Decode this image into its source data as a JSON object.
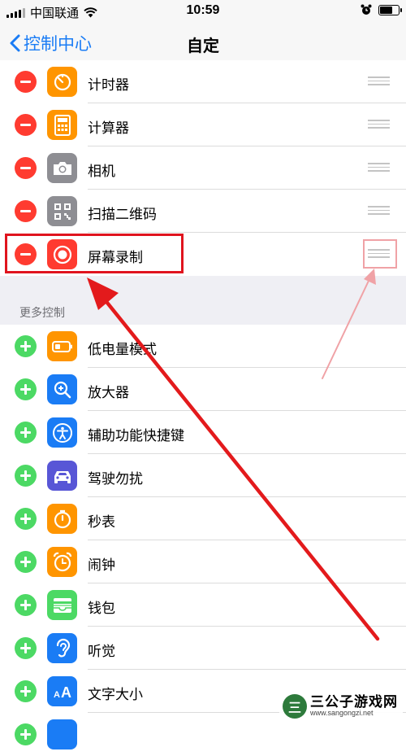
{
  "status_bar": {
    "carrier": "中国联通",
    "time": "10:59",
    "battery_level": 0.75
  },
  "nav": {
    "back_label": "控制中心",
    "title": "自定"
  },
  "included": [
    {
      "label": "计时器",
      "icon": "timer-icon",
      "color": "#ff9500"
    },
    {
      "label": "计算器",
      "icon": "calculator-icon",
      "color": "#ff9500"
    },
    {
      "label": "相机",
      "icon": "camera-icon",
      "color": "#8e8e93"
    },
    {
      "label": "扫描二维码",
      "icon": "qr-code-icon",
      "color": "#8e8e93"
    },
    {
      "label": "屏幕录制",
      "icon": "screen-record-icon",
      "color": "#ff3b30"
    }
  ],
  "more_controls": {
    "header": "更多控制",
    "items": [
      {
        "label": "低电量模式",
        "icon": "low-power-battery-icon",
        "color": "#ff9500"
      },
      {
        "label": "放大器",
        "icon": "magnifier-icon",
        "color": "#1a7cf5"
      },
      {
        "label": "辅助功能快捷键",
        "icon": "accessibility-icon",
        "color": "#1a7cf5"
      },
      {
        "label": "驾驶勿扰",
        "icon": "car-icon",
        "color": "#5856d6"
      },
      {
        "label": "秒表",
        "icon": "stopwatch-icon",
        "color": "#ff9500"
      },
      {
        "label": "闹钟",
        "icon": "alarm-clock-icon",
        "color": "#ff9500"
      },
      {
        "label": "钱包",
        "icon": "wallet-icon",
        "color": "#4cd964"
      },
      {
        "label": "听觉",
        "icon": "ear-icon",
        "color": "#1a7cf5"
      },
      {
        "label": "文字大小",
        "icon": "text-size-icon",
        "color": "#1a7cf5"
      }
    ]
  },
  "watermark": {
    "name": "三公子游戏网",
    "url": "www.sangongzi.net",
    "logo_char": "三"
  }
}
